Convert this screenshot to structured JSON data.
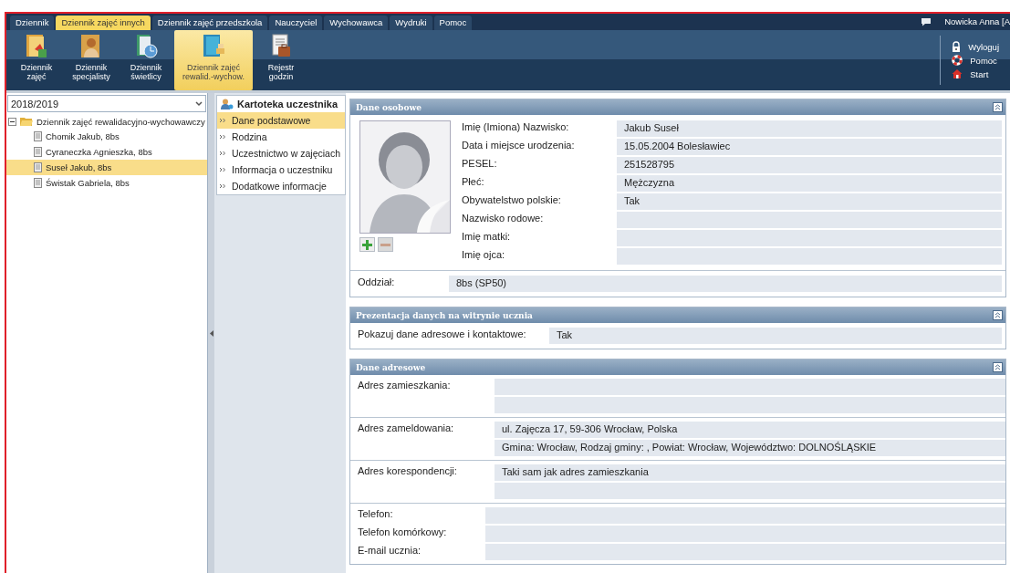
{
  "menu_tabs": [
    {
      "label": "Dziennik",
      "selected": false
    },
    {
      "label": "Dziennik zajęć innych",
      "selected": true
    },
    {
      "label": "Dziennik zajęć przedszkola",
      "selected": false
    },
    {
      "label": "Nauczyciel",
      "selected": false
    },
    {
      "label": "Wychowawca",
      "selected": false
    },
    {
      "label": "Wydruki",
      "selected": false
    },
    {
      "label": "Pomoc",
      "selected": false
    }
  ],
  "user": "Nowicka Anna [A",
  "toolbar": [
    {
      "lines": [
        "Dziennik",
        "zajęć"
      ],
      "kind": "journal",
      "selected": false
    },
    {
      "lines": [
        "Dziennik",
        "specjalisty"
      ],
      "kind": "specialist",
      "selected": false
    },
    {
      "lines": [
        "Dziennik",
        "świetlicy"
      ],
      "kind": "clock",
      "selected": false
    },
    {
      "lines": [
        "Dziennik zajęć",
        "rewalid.-wychow."
      ],
      "kind": "book",
      "selected": true
    },
    {
      "lines": [
        "Rejestr",
        "godzin"
      ],
      "kind": "register",
      "selected": false
    }
  ],
  "side_links": [
    {
      "label": "Wyloguj",
      "kind": "lock"
    },
    {
      "label": "Pomoc",
      "kind": "lifebuoy"
    },
    {
      "label": "Start",
      "kind": "home"
    }
  ],
  "year_select": {
    "value": "2018/2019"
  },
  "tree": {
    "label": "Dziennik zajęć rewalidacyjno-wychowawczy",
    "expanded": true,
    "children": [
      {
        "label": "Chomik Jakub, 8bs",
        "selected": false
      },
      {
        "label": "Cyraneczka Agnieszka, 8bs",
        "selected": false
      },
      {
        "label": "Suseł Jakub, 8bs",
        "selected": true
      },
      {
        "label": "Świstak Gabriela, 8bs",
        "selected": false
      }
    ]
  },
  "card_menu": {
    "title": "Kartoteka uczestnika",
    "items": [
      {
        "label": "Dane podstawowe",
        "selected": true
      },
      {
        "label": "Rodzina",
        "selected": false
      },
      {
        "label": "Uczestnictwo w zajęciach",
        "selected": false
      },
      {
        "label": "Informacja o uczestniku",
        "selected": false
      },
      {
        "label": "Dodatkowe informacje",
        "selected": false
      }
    ]
  },
  "personal": {
    "title": "Dane osobowe",
    "fields": [
      {
        "label": "Imię (Imiona) Nazwisko:",
        "value": "Jakub Suseł"
      },
      {
        "label": "Data i miejsce urodzenia:",
        "value": "15.05.2004 Bolesławiec"
      },
      {
        "label": "PESEL:",
        "value": "251528795"
      },
      {
        "label": "Płeć:",
        "value": "Mężczyzna"
      },
      {
        "label": "Obywatelstwo polskie:",
        "value": "Tak"
      },
      {
        "label": "Nazwisko rodowe:"
      },
      {
        "label": "Imię matki:"
      },
      {
        "label": "Imię ojca:"
      }
    ],
    "class_field": {
      "label": "Oddział:",
      "value": "8bs (SP50)"
    }
  },
  "presentation": {
    "title": "Prezentacja danych na witrynie ucznia",
    "fields": [
      {
        "label": "Pokazuj dane adresowe i kontaktowe:",
        "value": "Tak"
      }
    ]
  },
  "address": {
    "title": "Dane adresowe",
    "groups": [
      {
        "label": "Adres zamieszkania:",
        "rows": [
          {},
          {}
        ]
      },
      {
        "label": "Adres zameldowania:",
        "rows": [
          {
            "value": "ul. Zajęcza 17, 59-306 Wrocław, Polska"
          },
          {
            "value": "Gmina: Wrocław, Rodzaj gminy: , Powiat: Wrocław, Województwo: DOLNOŚLĄSKIE"
          }
        ]
      },
      {
        "label": "Adres korespondencji:",
        "rows": [
          {
            "value": "Taki sam jak adres zamieszkania"
          },
          {}
        ]
      }
    ],
    "fields": [
      {
        "label": "Telefon:"
      },
      {
        "label": "Telefon komórkowy:"
      },
      {
        "label": "E-mail ucznia:"
      }
    ]
  }
}
